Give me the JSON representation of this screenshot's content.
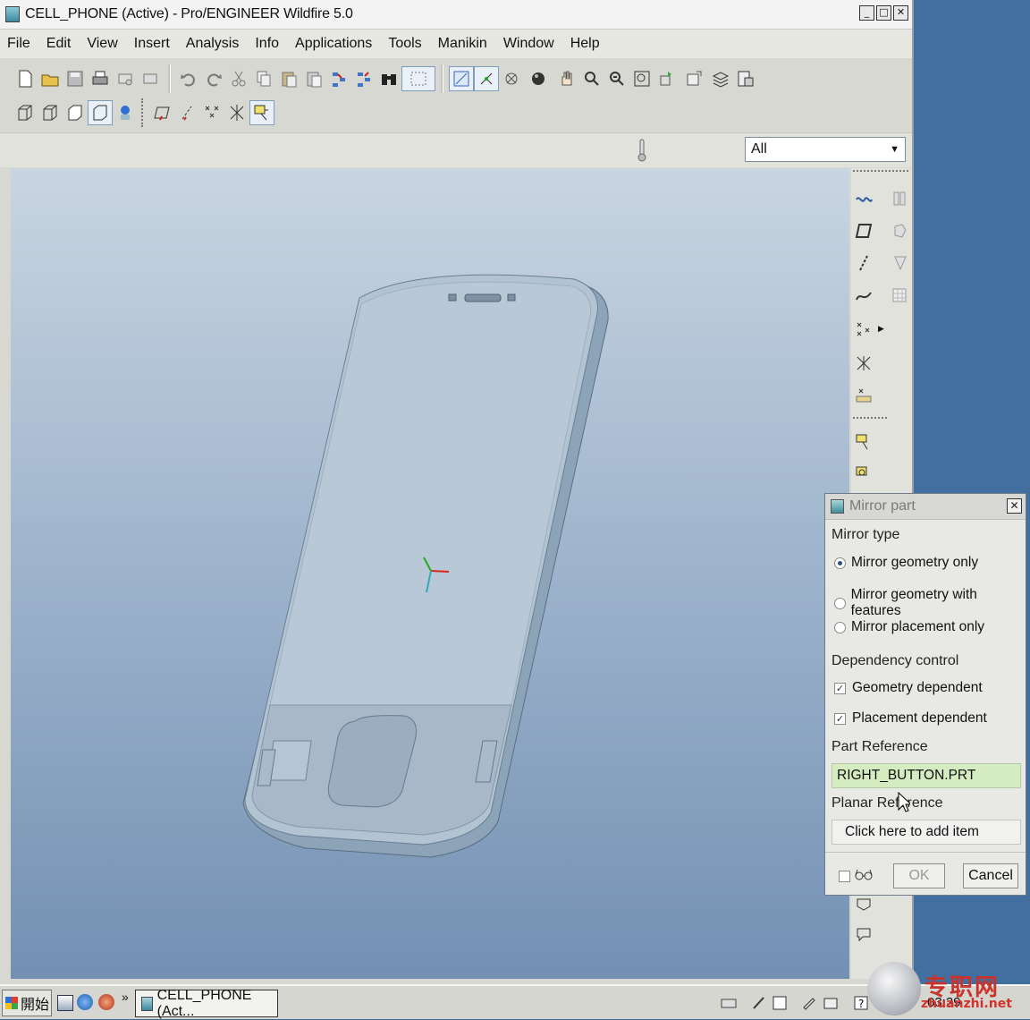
{
  "window": {
    "title": "CELL_PHONE (Active) - Pro/ENGINEER Wildfire 5.0",
    "controls": [
      "_",
      "□",
      "✕"
    ]
  },
  "menubar": [
    "File",
    "Edit",
    "View",
    "Insert",
    "Analysis",
    "Info",
    "Applications",
    "Tools",
    "Manikin",
    "Window",
    "Help"
  ],
  "toolbar": {
    "filter_value": "All"
  },
  "dialog": {
    "title": "Mirror part",
    "mirror_type_label": "Mirror type",
    "options": [
      "Mirror geometry only",
      "Mirror geometry with features",
      "Mirror placement only"
    ],
    "selected_option": "Mirror geometry only",
    "dependency_label": "Dependency control",
    "checks": [
      {
        "label": "Geometry dependent",
        "checked": true
      },
      {
        "label": "Placement dependent",
        "checked": true
      }
    ],
    "part_reference_label": "Part Reference",
    "part_reference_value": "RIGHT_BUTTON.PRT",
    "planar_reference_label": "Planar Reference",
    "planar_reference_placeholder": "Click here to add item",
    "ok_label": "OK",
    "cancel_label": "Cancel"
  },
  "taskbar": {
    "start_label": "開始",
    "task_label": "CELL_PHONE (Act...",
    "clock": "03:29"
  },
  "watermark": {
    "text": "专职网",
    "url": "zhuanzhi.net"
  }
}
